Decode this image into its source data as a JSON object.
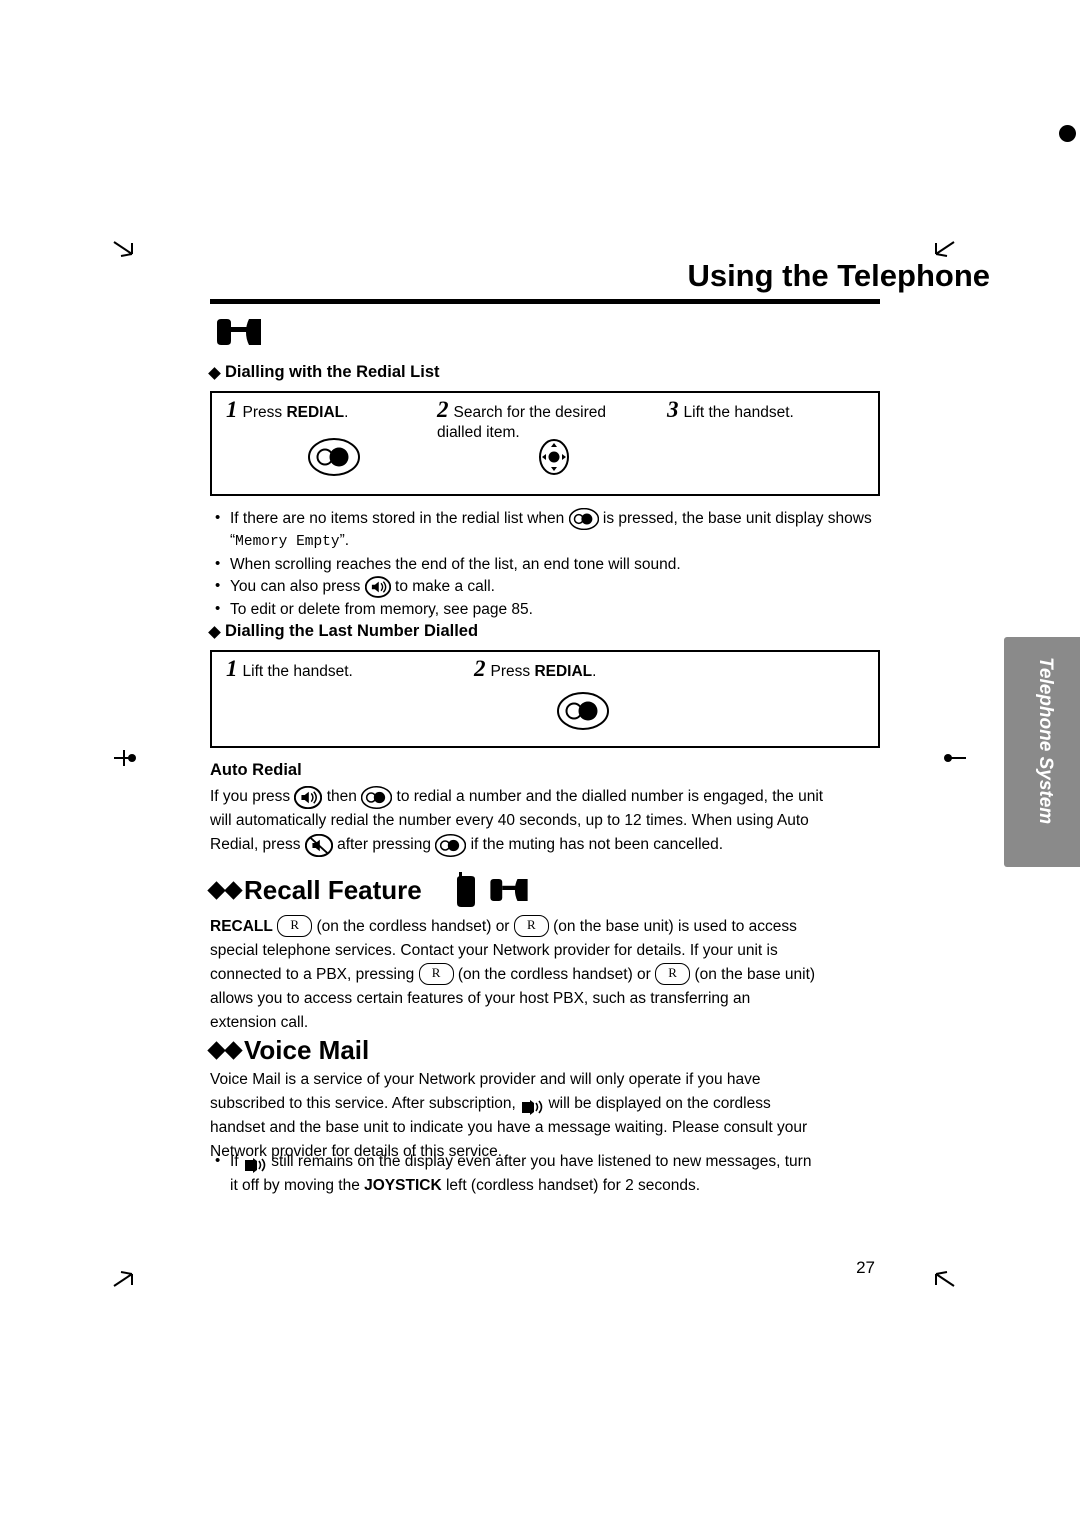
{
  "document": {
    "chapter_title": "Using the Telephone",
    "page_number": "27",
    "side_tab_label": "Telephone System"
  },
  "section_redial_list": {
    "heading": "Dialling with the Redial List",
    "steps": [
      {
        "num": "1",
        "text": "Press ",
        "bold": "REDIAL",
        "tail": ".",
        "icon": "redial-button-icon"
      },
      {
        "num": "2",
        "text": "Search for the desired dialled item.",
        "icon": "joystick-icon"
      },
      {
        "num": "3",
        "text": "Lift the handset.",
        "icon": ""
      }
    ],
    "notes": [
      {
        "pre": "If there are no items stored in the redial list when ",
        "icon": "redial-button-icon",
        "mid": " is pressed, the base unit display shows “",
        "mono": "Memory Empty",
        "post": "”."
      },
      {
        "pre": "When scrolling reaches the end of the list, an end tone will sound."
      },
      {
        "pre": "You can also press ",
        "icon": "speakerphone-icon",
        "mid": " to make a call."
      },
      {
        "pre": "To edit or delete from memory, see page 85."
      }
    ]
  },
  "section_last_number": {
    "heading": "Dialling the Last Number Dialled",
    "steps": [
      {
        "num": "1",
        "text": "Lift the handset."
      },
      {
        "num": "2",
        "text": "Press ",
        "bold": "REDIAL",
        "tail": ".",
        "icon": "redial-button-icon"
      }
    ]
  },
  "auto_redial": {
    "heading": "Auto Redial",
    "line1_a": "If you press ",
    "line1_icon1": "speakerphone-icon",
    "line1_b": " then ",
    "line1_icon2": "redial-button-icon",
    "line1_c": " to redial a number and the dialled number is engaged, the unit",
    "line2": "will automatically redial the number every 40 seconds, up to 12 times. When using Auto",
    "line3_a": "Redial, press ",
    "line3_icon1": "mute-icon",
    "line3_b": " after pressing ",
    "line3_icon2": "redial-button-icon",
    "line3_c": " if the muting has not been cancelled."
  },
  "recall_feature": {
    "heading": "Recall Feature",
    "icons": [
      "cordless-handset-icon",
      "base-unit-icon"
    ],
    "line1_a": "RECALL",
    "line1_key1": "R",
    "line1_b": " (on the cordless handset) or ",
    "line1_key2": "R",
    "line1_c": " (on the base unit) is used to access",
    "line2": "special telephone services. Contact your Network provider for details. If your unit is",
    "line3_a": "connected to a PBX, pressing ",
    "line3_key1": "R",
    "line3_b": " (on the cordless handset) or ",
    "line3_key2": "R",
    "line3_c": " (on the base unit)",
    "line4": "allows you to access certain features of your host PBX, such as transferring an",
    "line5": "extension call."
  },
  "voice_mail": {
    "heading": "Voice Mail",
    "line1": "Voice Mail is a service of your Network provider and will only operate if you have",
    "line2_a": "subscribed to this service. After subscription, ",
    "line2_icon": "voice-mail-indicator-icon",
    "line2_b": " will be displayed on the cordless",
    "line3": "handset and the base unit to indicate you have a message waiting. Please consult your",
    "line4": "Network provider for details of this service.",
    "bullet_a": "If ",
    "bullet_icon": "voice-mail-indicator-icon",
    "bullet_b": " still remains on the display even after you have listened to new messages, turn",
    "bullet_c1": "it off by moving the ",
    "bullet_bold": "JOYSTICK",
    "bullet_c2": " left (cordless handset) for 2 seconds."
  },
  "colors": {
    "text": "#000000",
    "side_tab_bg": "#8a8a8a",
    "page_bg": "#ffffff"
  }
}
